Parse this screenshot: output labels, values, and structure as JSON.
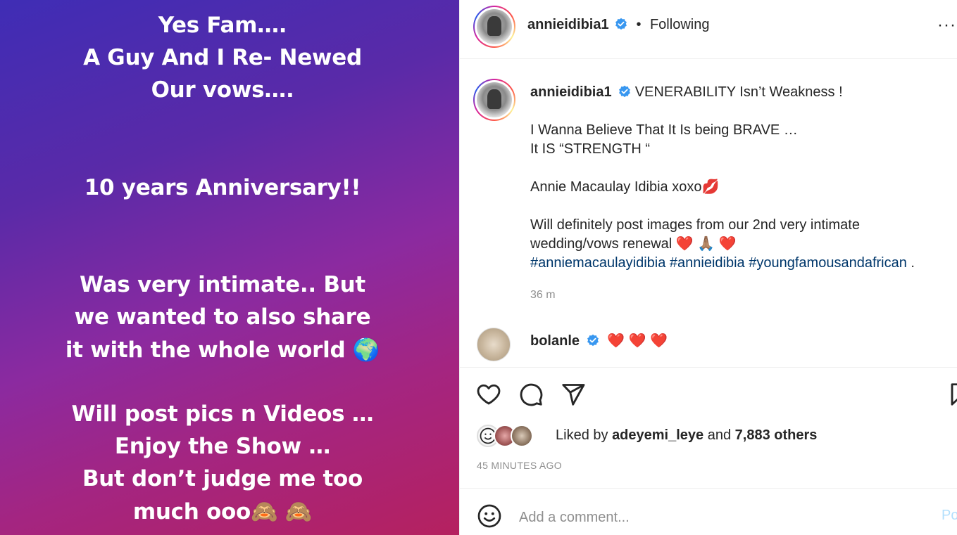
{
  "story": {
    "lines": [
      "Yes Fam….",
      "A Guy And I Re- Newed",
      "Our vows….",
      "10 years Anniversary!!",
      "Was very intimate.. But",
      "we wanted to also share",
      "it with the whole world 🌍",
      "Will post pics n Videos …",
      "Enjoy the Show …",
      "But don’t judge me too",
      "much ooo🙈 🙈"
    ]
  },
  "header": {
    "username": "annieidibia1",
    "dot": "•",
    "follow_status": "Following",
    "more_label": "···"
  },
  "caption": {
    "username": "annieidibia1",
    "line1": "VENERABILITY Isn’t Weakness !",
    "line2": "I Wanna Believe That It Is being BRAVE …",
    "line3": "It IS “STRENGTH “",
    "line4": "Annie Macaulay Idibia xoxo💋",
    "line5": "Will definitely post images from our 2nd very intimate",
    "line6": "wedding/vows renewal ❤️ 🙏🏽 ❤️",
    "hashtags": [
      "#anniemacaulayidibia",
      "#annieidibia",
      "#youngfamousandafrican"
    ],
    "trailing": " .",
    "time": "36 m"
  },
  "comment": {
    "username": "bolanle",
    "text": "❤️ ❤️ ❤️"
  },
  "likes": {
    "prefix": "Liked by",
    "user": "adeyemi_leye",
    "and": "and",
    "others": "7,883 others"
  },
  "post_time": "45 MINUTES AGO",
  "add_comment": {
    "placeholder": "Add a comment...",
    "post_label": "Post"
  },
  "colors": {
    "verified": "#3897f0",
    "hashtag": "#00376b",
    "post_button": "#b2dffc"
  }
}
